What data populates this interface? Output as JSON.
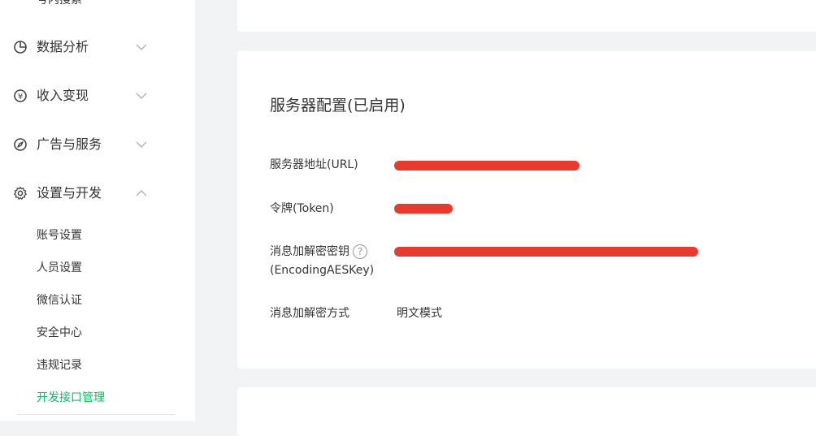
{
  "sidebar": {
    "cut_item_label": "号内搜索",
    "groups": [
      {
        "label": "数据分析",
        "icon": "pie-chart-icon",
        "expanded": false
      },
      {
        "label": "收入变现",
        "icon": "yen-icon",
        "expanded": false
      },
      {
        "label": "广告与服务",
        "icon": "compass-icon",
        "expanded": false
      },
      {
        "label": "设置与开发",
        "icon": "gear-icon",
        "expanded": true
      }
    ],
    "sub_items": [
      {
        "label": "账号设置"
      },
      {
        "label": "人员设置"
      },
      {
        "label": "微信认证"
      },
      {
        "label": "安全中心"
      },
      {
        "label": "违规记录"
      },
      {
        "label": "开发接口管理",
        "active": true
      }
    ]
  },
  "server_config": {
    "title": "服务器配置(已启用)",
    "url_label": "服务器地址(URL)",
    "token_label": "令牌(Token)",
    "aes_label_line1": "消息加解密密钥",
    "aes_label_line2": "(EncodingAESKey)",
    "help_glyph": "?",
    "mode_label": "消息加解密方式",
    "mode_value": "明文模式"
  },
  "colors": {
    "accent_green": "#07c160",
    "redaction_red": "#e83b2e",
    "page_bg": "#f2f3f5"
  }
}
